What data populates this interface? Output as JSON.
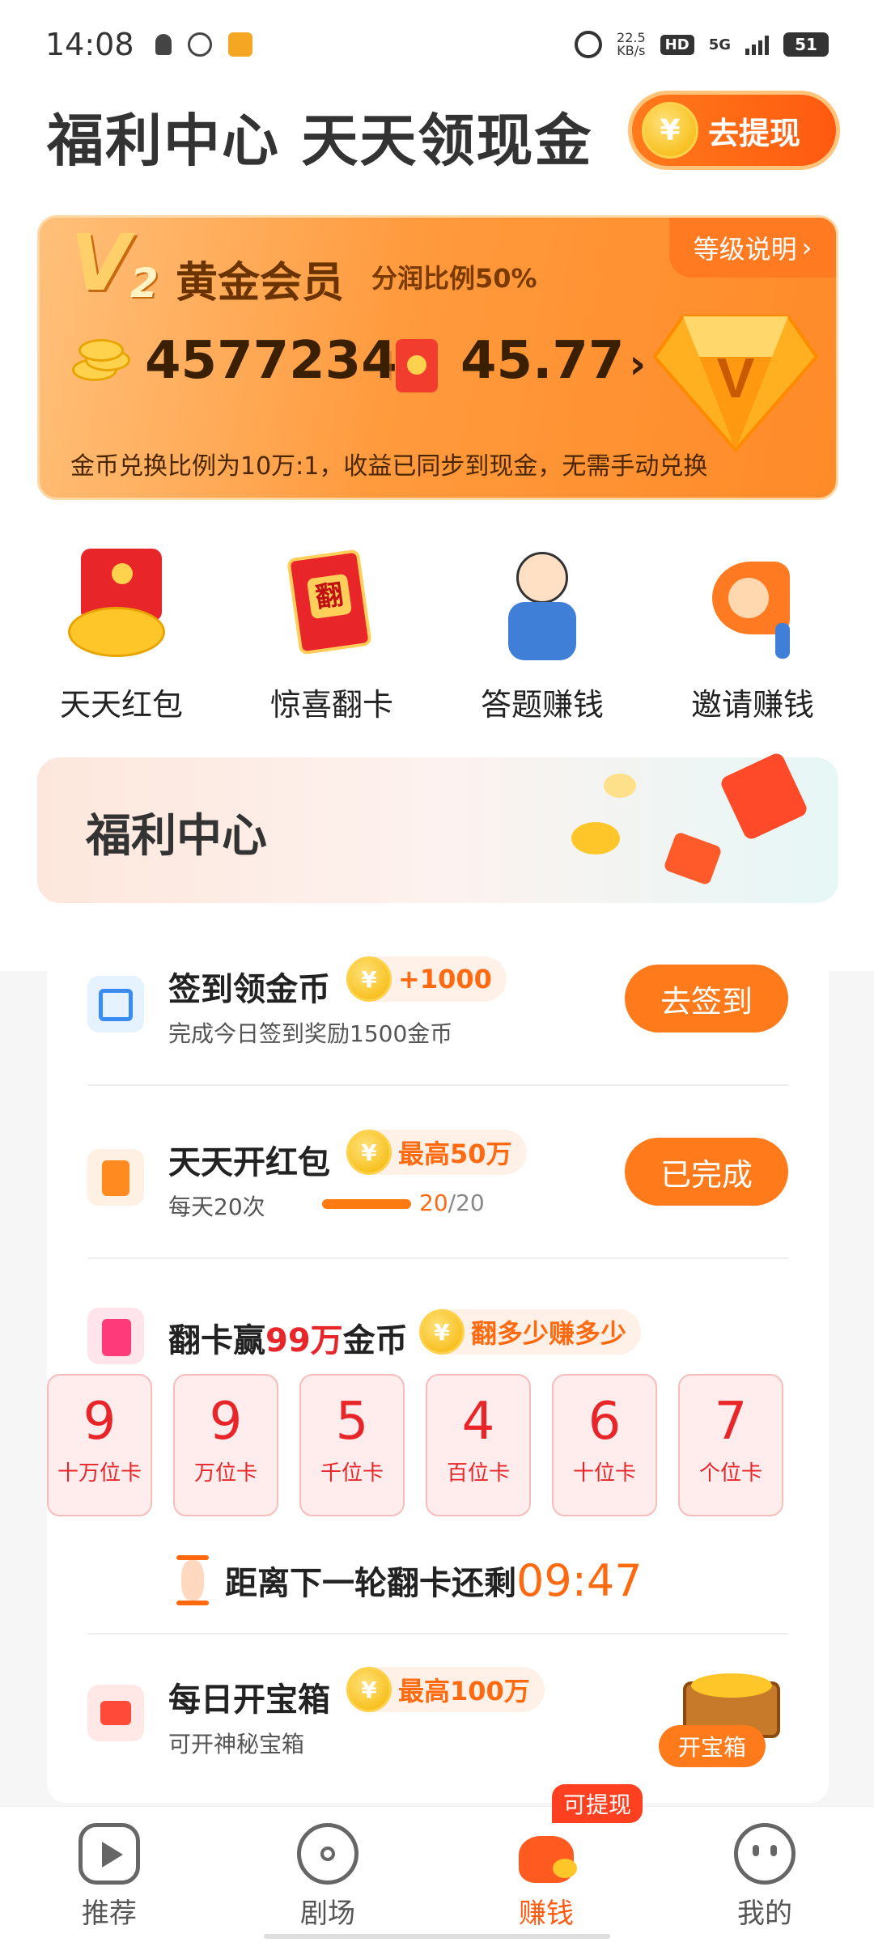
{
  "status_bar": {
    "time": "14:08",
    "net_speed_value": "22.5",
    "net_speed_unit": "KB/s",
    "hd": "HD",
    "network": "5G",
    "battery": "51"
  },
  "header": {
    "title": "福利中心 天天领现金",
    "withdraw_label": "去提现",
    "coin_symbol": "¥"
  },
  "vip": {
    "badge": "V",
    "level": "2",
    "name": "黄金会员",
    "ratio": "分润比例50%",
    "level_link": "等级说明",
    "coins": "4577234",
    "cash": "45.77",
    "note": "金币兑换比例为10万:1，收益已同步到现金，无需手动兑换"
  },
  "shortcuts": [
    {
      "label": "天天红包",
      "icon": "red-envelope-gold-icon"
    },
    {
      "label": "惊喜翻卡",
      "icon": "flip-card-icon"
    },
    {
      "label": "答题赚钱",
      "icon": "quiz-character-icon"
    },
    {
      "label": "邀请赚钱",
      "icon": "megaphone-icon"
    }
  ],
  "welfare": {
    "title": "福利中心"
  },
  "tasks": {
    "checkin": {
      "title": "签到领金币",
      "reward": "+1000",
      "sub": "完成今日签到奖励1500金币",
      "button": "去签到"
    },
    "redpack": {
      "title": "天天开红包",
      "reward": "最高50万",
      "sub": "每天20次",
      "progress_done": "20",
      "progress_total": "/20",
      "progress_fraction": 1.0,
      "button": "已完成"
    },
    "flip": {
      "title_prefix": "翻卡赢",
      "title_highlight": "99万",
      "title_suffix": "金币",
      "reward": "翻多少赚多少",
      "cards": [
        {
          "num": "9",
          "cap": "十万位卡"
        },
        {
          "num": "9",
          "cap": "万位卡"
        },
        {
          "num": "5",
          "cap": "千位卡"
        },
        {
          "num": "4",
          "cap": "百位卡"
        },
        {
          "num": "6",
          "cap": "十位卡"
        },
        {
          "num": "7",
          "cap": "个位卡"
        }
      ],
      "countdown_label": "距离下一轮翻卡还剩",
      "countdown_time": "09:47"
    },
    "chest": {
      "title": "每日开宝箱",
      "reward": "最高100万",
      "sub": "可开神秘宝箱",
      "button": "开宝箱"
    }
  },
  "tabbar": {
    "items": [
      {
        "label": "推荐",
        "icon": "play-icon"
      },
      {
        "label": "剧场",
        "icon": "film-reel-icon"
      },
      {
        "label": "赚钱",
        "icon": "money-bag-icon"
      },
      {
        "label": "我的",
        "icon": "face-icon"
      }
    ],
    "withdraw_tag": "可提现"
  },
  "colors": {
    "accent": "#ff7a1a",
    "card_red": "#e8262a",
    "vip_gradient_end": "#ff8a28"
  }
}
